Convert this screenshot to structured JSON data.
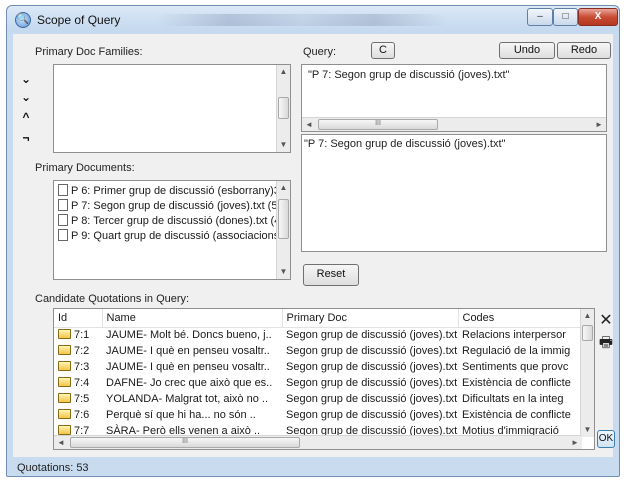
{
  "window": {
    "title": "Scope of Query",
    "controls": {
      "minimize": "–",
      "maximize": "□",
      "close": "X"
    }
  },
  "families": {
    "label": "Primary Doc Families:",
    "tools": [
      "⌄",
      "⌄",
      "^",
      "¬"
    ]
  },
  "documents": {
    "label": "Primary Documents:",
    "items": [
      "P 6: Primer grup de discussió (esborrany)3.",
      "P 7: Segon grup de discussió (joves).txt (53",
      "P 8: Tercer grup de discussió (dones).txt (4",
      "P 9: Quart grup de discussió (associacions"
    ]
  },
  "query": {
    "label": "Query:",
    "clear_label": "C",
    "undo_label": "Undo",
    "redo_label": "Redo",
    "stack_text": "\"P 7: Segon grup de discussió (joves).txt\"",
    "result_text": "\"P 7: Segon grup de discussió (joves).txt\"",
    "reset_label": "Reset"
  },
  "candidates": {
    "label": "Candidate Quotations in Query:",
    "columns": [
      "Id",
      "Name",
      "Primary Doc",
      "Codes"
    ],
    "rows": [
      {
        "id": "7:1",
        "name": "JAUME- Molt bé. Doncs bueno, j..",
        "doc": "Segon grup de discussió (joves).txt",
        "codes": "Relacions interpersor"
      },
      {
        "id": "7:2",
        "name": "JAUME- I què en penseu vosaltr..",
        "doc": "Segon grup de discussió (joves).txt",
        "codes": "Regulació de la immig"
      },
      {
        "id": "7:3",
        "name": "JAUME- I què en penseu vosaltr..",
        "doc": "Segon grup de discussió (joves).txt",
        "codes": "Sentiments que provc"
      },
      {
        "id": "7:4",
        "name": "DAFNE- Jo crec que això que es..",
        "doc": "Segon grup de discussió (joves).txt",
        "codes": "Existència de conflicte"
      },
      {
        "id": "7:5",
        "name": "YOLANDA- Malgrat tot, això no ..",
        "doc": "Segon grup de discussió (joves).txt",
        "codes": "Dificultats en la integ"
      },
      {
        "id": "7:6",
        "name": "Perquè sí que hi ha... no són ..",
        "doc": "Segon grup de discussió (joves).txt",
        "codes": "Existència de conflicte"
      },
      {
        "id": "7:7",
        "name": "SÀRA- Però ells venen a això ..",
        "doc": "Segon grup de discussió (joves).txt",
        "codes": "Motius d'immigració"
      }
    ],
    "side_icons": {
      "delete": "✕",
      "print": "🖶"
    },
    "ok_label": "OK"
  },
  "status": {
    "text": "Quotations: 53"
  }
}
